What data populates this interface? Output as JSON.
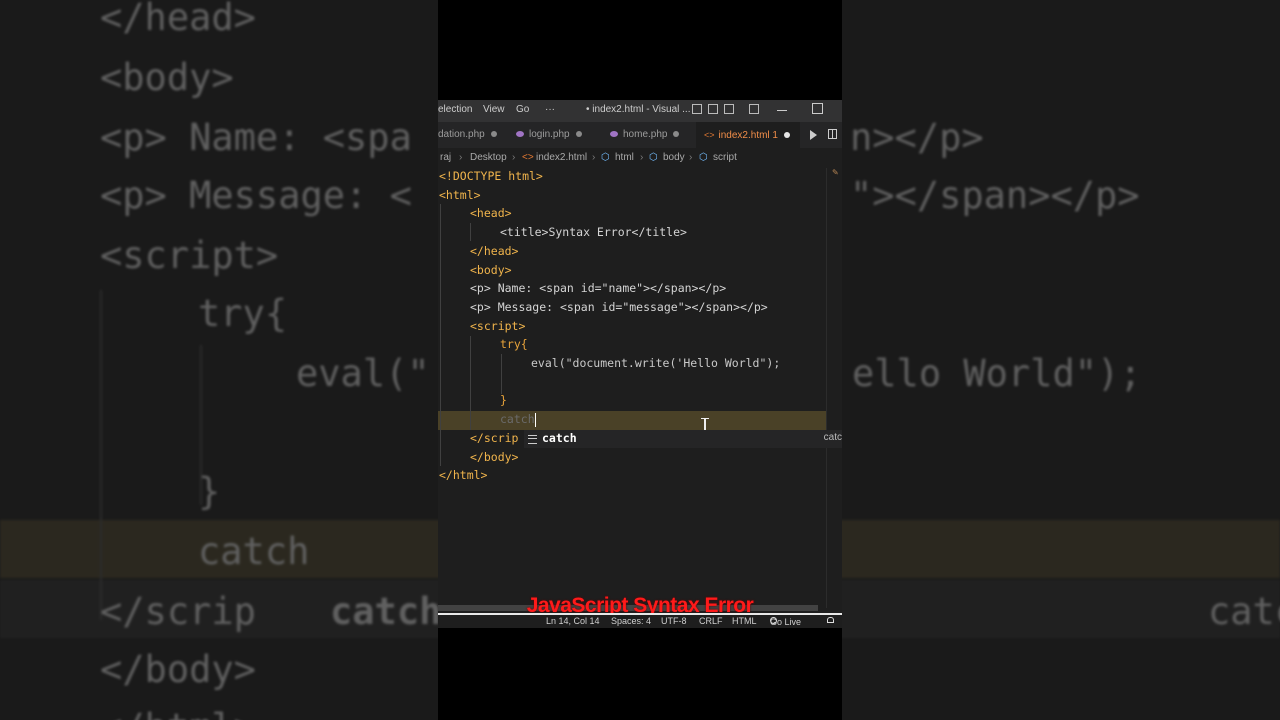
{
  "menu": {
    "selection": "election",
    "view": "View",
    "go": "Go",
    "more": "···",
    "title": "• index2.html - Visual ..."
  },
  "tabs": [
    {
      "label": "dation.php",
      "icon": "php-icon",
      "dirty": true
    },
    {
      "label": "login.php",
      "icon": "php-icon",
      "dirty": true
    },
    {
      "label": "home.php",
      "icon": "php-icon",
      "dirty": true
    },
    {
      "label": "index2.html 1",
      "icon": "html-icon",
      "dirty": true,
      "active": true
    }
  ],
  "breadcrumb": {
    "root": "raj",
    "folder": "Desktop",
    "file": "index2.html",
    "n1": "html",
    "n2": "body",
    "n3": "script"
  },
  "code": {
    "doctype": "<!DOCTYPE html>",
    "html_open": "<html>",
    "head_open": "<head>",
    "title_line": "<title>Syntax Error</title>",
    "head_close": "</head>",
    "body_open": "<body>",
    "p_name": "<p> Name: <span id=\"name\"></span></p>",
    "p_message": "<p> Message: <span id=\"message\"></span></p>",
    "script_open": "<script>",
    "try_line": "try{",
    "eval_line": "eval(\"document.write('Hello World\");",
    "brace_close": "}",
    "catch_typed": "catch",
    "script_close_partial": "</scrip",
    "body_close": "</body>",
    "html_close": "</html>"
  },
  "suggestion": {
    "label": "catch",
    "detail": "catc"
  },
  "overlay": {
    "title": "JavaScript Syntax Error"
  },
  "status": {
    "position": "Ln 14, Col 14",
    "spaces": "Spaces: 4",
    "encoding": "UTF-8",
    "eol": "CRLF",
    "language": "HTML",
    "golive": "Go Live"
  },
  "background": {
    "l1": "</head>",
    "l2": "<body>",
    "l3a": "<p> Name: <spa",
    "l3b": "n></p>",
    "l4a": "<p> Message: <",
    "l4b": "\"></span></p>",
    "l5": "<script>",
    "l6": "try{",
    "l7a": "eval(\"",
    "l7b": "ello World\");",
    "l8": "}",
    "l9": "catch",
    "l10a": "</scrip",
    "l10b": "catch",
    "l10c": "catc",
    "l11": "</body>",
    "l12": "</html>"
  }
}
